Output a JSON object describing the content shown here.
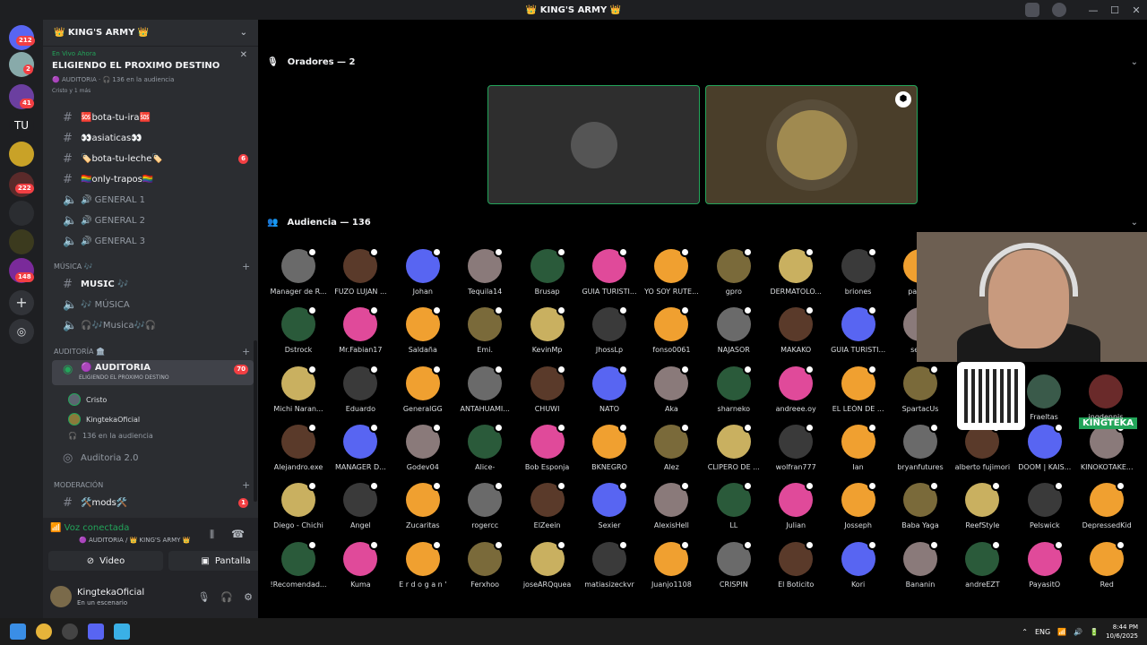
{
  "window": {
    "title": "👑 KING'S ARMY 👑"
  },
  "guilds": {
    "badges": [
      "212",
      "2",
      "41",
      "222",
      "148"
    ],
    "tu_label": "TU"
  },
  "server": {
    "name": "👑 KING'S ARMY 👑",
    "live": {
      "tag": "En Vivo Ahora",
      "title": "ELIGIENDO EL PROXIMO DESTINO",
      "sub": "🟣 AUDITORIA · 🎧 136 en la audiencia",
      "sub2": "Cristo y 1 más"
    },
    "channels": [
      {
        "label": "🆘bota-tu-ira🆘"
      },
      {
        "label": "👀asiaticas👀"
      },
      {
        "label": "🏷️bota-tu-leche🏷️",
        "badge": "6"
      },
      {
        "label": "🏳️‍🌈only-trapos🏳️‍🌈"
      },
      {
        "label": "🔊 GENERAL 1"
      },
      {
        "label": "🔊 GENERAL 2"
      },
      {
        "label": "🔊 GENERAL 3"
      }
    ],
    "music_category": "MÚSICA 🎶",
    "music_channels": [
      {
        "label": "𝗠𝗨𝗦𝗜𝗖 🎶"
      },
      {
        "label": "🎶 MÚSICA"
      },
      {
        "label": "🎧🎶Musica🎶🎧"
      }
    ],
    "auditoria_category": "AUDITORÍA 🏛️",
    "auditoria_channel": {
      "label": "🟣 AUDITORIA",
      "sub": "ELIGIENDO EL PROXIMO DESTINO",
      "badge": "70"
    },
    "stage_users": [
      "Cristo",
      "KingtekaOficial"
    ],
    "audience_count": "136 en la audiencia",
    "auditoria2": "Auditoria 2.0",
    "mod_category": "MODERACIÓN",
    "mods_channel": {
      "label": "🛠️mods🛠️",
      "badge": "1"
    }
  },
  "voice_panel": {
    "status": "Voz conectada",
    "sub": "🟣 AUDITORIA / 👑 KING'S ARMY 👑",
    "video_label": "Video",
    "screen_label": "Pantalla",
    "user_name": "KingtekaOficial",
    "user_status": "En un escenario"
  },
  "stage": {
    "speakers_header": "Oradores — 2",
    "audience_header": "Audiencia — 136",
    "audience": [
      "Manager de R...",
      "FUZO LUJAN ...",
      "Johan",
      "Tequila14",
      "Brusap",
      "GUIA TURISTI...",
      "YO SOY RUTE...",
      "gpro",
      "DERMATOLO...",
      "briones",
      "pana...",
      "Dstrock",
      "Mr.Fabian17",
      "Saldaña",
      "Emi.",
      "KevinMp",
      "JhossLp",
      "fonso0061",
      "NAJASOR",
      "MAKAKO",
      "GUIA TURISTI...",
      "seb...",
      "Michi Naran...",
      "Eduardo",
      "GeneralGG",
      "ANTAHUAMI...",
      "CHUWI",
      "NATO",
      "Aka",
      "sharneko",
      "andreee.oy",
      "EL LEÓN DE ...",
      "SpartacUs",
      "Alejandro.exe",
      "MANAGER D...",
      "Godev04",
      "Alice-",
      "Bob Esponja",
      "BKNEGRO",
      "Alez",
      "CLIPERO DE ...",
      "wolfran777",
      "Ian",
      "bryanfutures",
      "alberto fujimori",
      "DOOM | KAIS...",
      "KINOKOTAKE...",
      "Diego - Chichi",
      "Angel",
      "Zucaritas",
      "rogercc",
      "ElZeein",
      "Sexier",
      "AlexisHell",
      "LL",
      "Julian",
      "Josseph",
      "Baba Yaga",
      "ReefStyle",
      "Pelswick",
      "DepressedKid",
      "!Recomendad...",
      "Kuma",
      "E r d o g a n '",
      "Ferxhoo",
      "joseARQquea",
      "matiasizeckvr",
      "Juanjo1108",
      "CRISPIN",
      "El Boticito",
      "Kori",
      "Bananin",
      "andreEZT",
      "PayasitO",
      "Red"
    ],
    "overlay_names": [
      "Fraeltas",
      "ingdennis"
    ],
    "stake_label": "KINGTEKA"
  },
  "taskbar": {
    "lang": "ENG",
    "time": "8:44 PM",
    "date": "10/6/2025"
  }
}
